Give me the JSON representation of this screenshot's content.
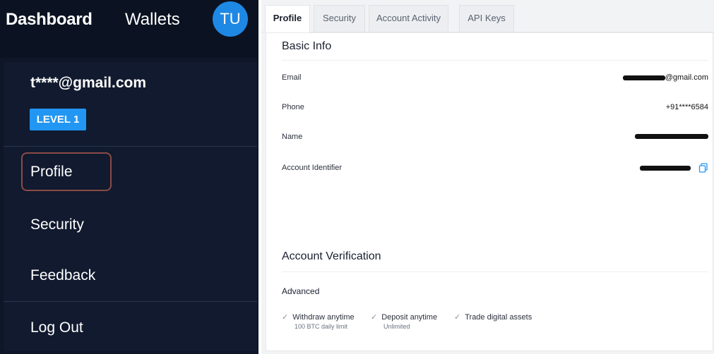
{
  "topbar": {
    "dashboard_label": "Dashboard",
    "wallets_label": "Wallets",
    "avatar_initials": "TU"
  },
  "user": {
    "email": "t****@gmail.com",
    "level": "LEVEL 1"
  },
  "menu": {
    "items": [
      {
        "label": "Profile",
        "selected": true
      },
      {
        "label": "Security"
      },
      {
        "label": "Feedback"
      },
      {
        "label": "Log Out"
      }
    ]
  },
  "tabs": [
    {
      "label": "Profile",
      "active": true
    },
    {
      "label": "Security"
    },
    {
      "label": "Account Activity"
    },
    {
      "label": "API Keys"
    }
  ],
  "basic_info": {
    "title": "Basic Info",
    "fields": [
      {
        "label": "Email",
        "value": "@gmail.com"
      },
      {
        "label": "Phone",
        "value": "+91****6584"
      },
      {
        "label": "Name",
        "value": ""
      },
      {
        "label": "Account Identifier",
        "value": ""
      }
    ]
  },
  "verification": {
    "title": "Account Verification",
    "level": "Advanced",
    "features": [
      {
        "title": "Withdraw anytime",
        "sub": "100 BTC daily limit"
      },
      {
        "title": "Deposit anytime",
        "sub": "Unlimited"
      },
      {
        "title": "Trade digital assets",
        "sub": ""
      }
    ]
  },
  "colors": {
    "panel_bg": "#0e1627",
    "accent": "#2196f3",
    "selection_border": "#8a4a47"
  },
  "icons": {
    "copy": "copy-icon",
    "check": "check-icon"
  }
}
